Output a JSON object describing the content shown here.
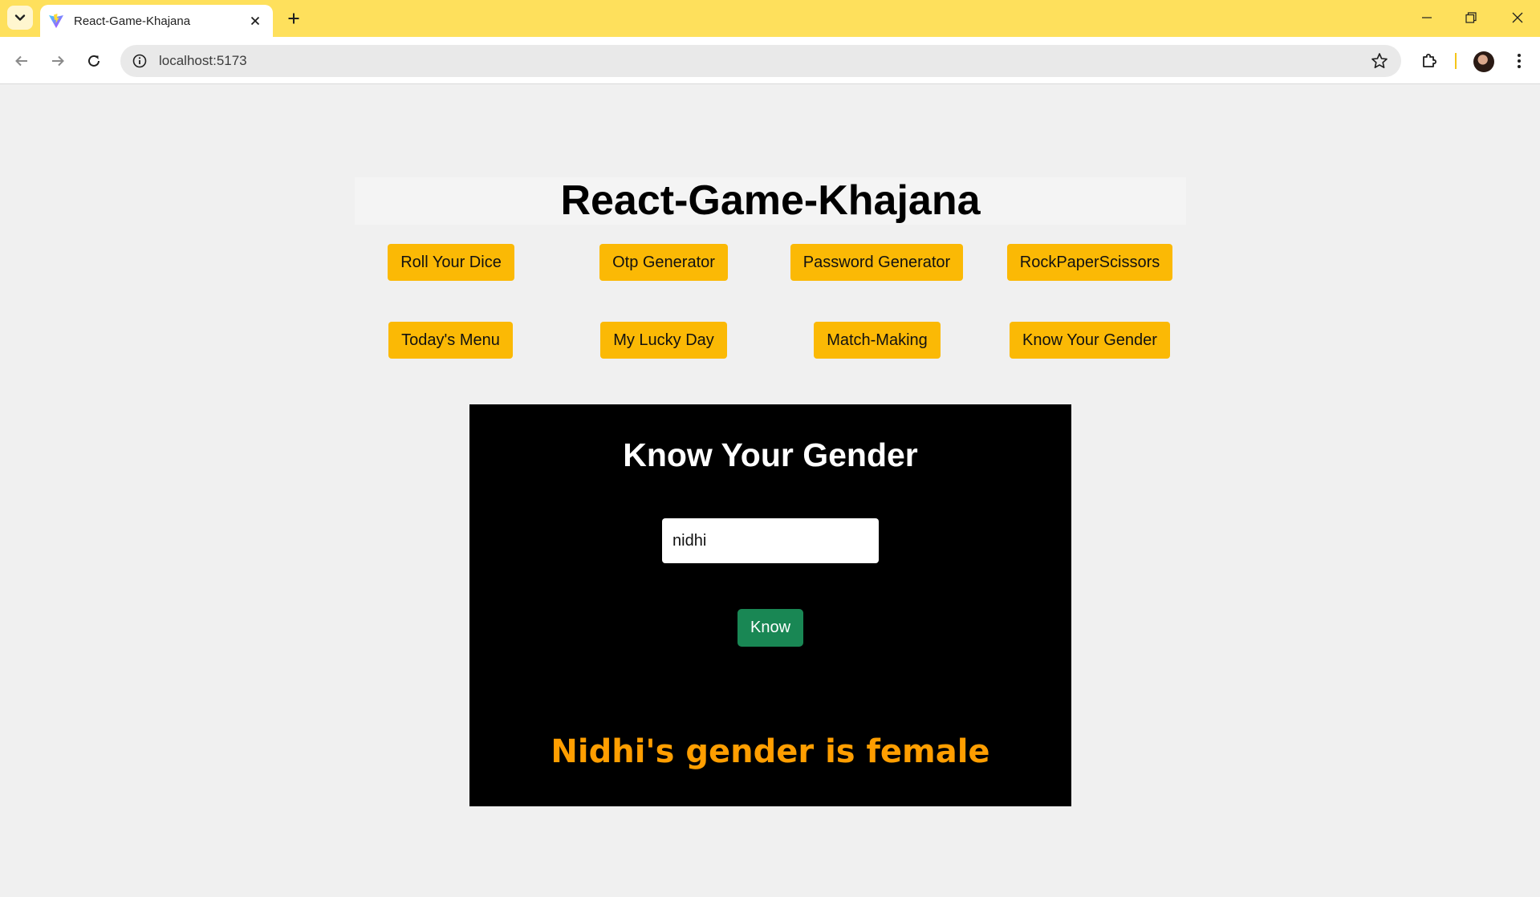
{
  "browser": {
    "tab_title": "React-Game-Khajana",
    "url": "localhost:5173"
  },
  "app": {
    "title": "React-Game-Khajana",
    "nav_row1": [
      "Roll Your Dice",
      "Otp Generator",
      "Password Generator",
      "RockPaperScissors"
    ],
    "nav_row2": [
      "Today's Menu",
      "My Lucky Day",
      "Match-Making",
      "Know Your Gender"
    ]
  },
  "panel": {
    "title": "Know Your Gender",
    "input_value": "nidhi",
    "button_label": "Know",
    "result": "Nidhi's gender is female"
  },
  "colors": {
    "tabstrip": "#fee05c",
    "nav_button": "#fbb905",
    "know_button": "#198754",
    "result_text": "#ff9e00"
  }
}
